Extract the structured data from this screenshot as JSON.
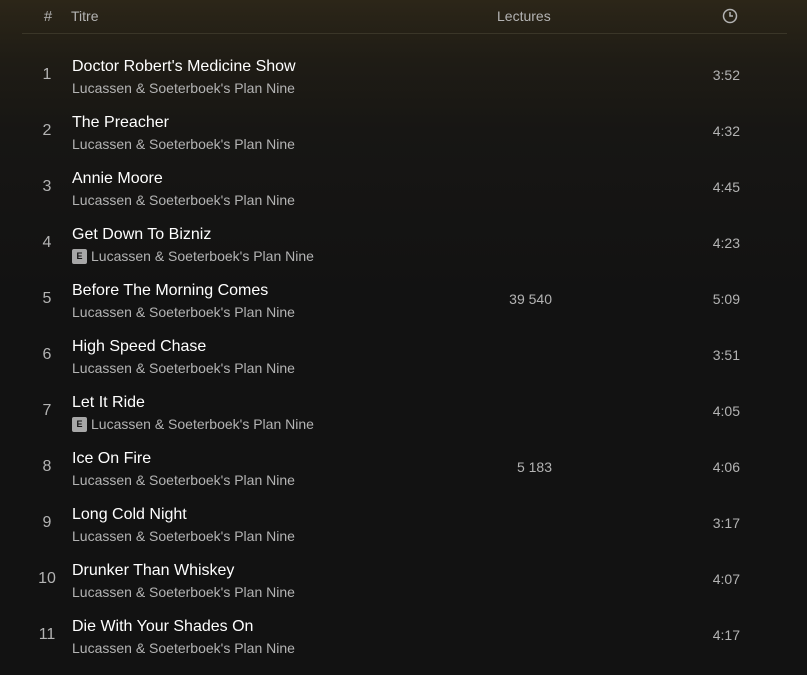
{
  "header": {
    "num_label": "#",
    "title_label": "Titre",
    "plays_label": "Lectures",
    "duration_icon": "clock-icon"
  },
  "tracks": [
    {
      "num": "1",
      "title": "Doctor Robert's Medicine Show",
      "artist": "Lucassen & Soeterboek's Plan Nine",
      "explicit": false,
      "explicit_label": "",
      "plays": "",
      "duration": "3:52"
    },
    {
      "num": "2",
      "title": "The Preacher",
      "artist": "Lucassen & Soeterboek's Plan Nine",
      "explicit": false,
      "explicit_label": "",
      "plays": "",
      "duration": "4:32"
    },
    {
      "num": "3",
      "title": "Annie Moore",
      "artist": "Lucassen & Soeterboek's Plan Nine",
      "explicit": false,
      "explicit_label": "",
      "plays": "",
      "duration": "4:45"
    },
    {
      "num": "4",
      "title": "Get Down To Bizniz",
      "artist": "Lucassen & Soeterboek's Plan Nine",
      "explicit": true,
      "explicit_label": "E",
      "plays": "",
      "duration": "4:23"
    },
    {
      "num": "5",
      "title": "Before The Morning Comes",
      "artist": "Lucassen & Soeterboek's Plan Nine",
      "explicit": false,
      "explicit_label": "",
      "plays": "39 540",
      "duration": "5:09"
    },
    {
      "num": "6",
      "title": "High Speed Chase",
      "artist": "Lucassen & Soeterboek's Plan Nine",
      "explicit": false,
      "explicit_label": "",
      "plays": "",
      "duration": "3:51"
    },
    {
      "num": "7",
      "title": "Let It Ride",
      "artist": "Lucassen & Soeterboek's Plan Nine",
      "explicit": true,
      "explicit_label": "E",
      "plays": "",
      "duration": "4:05"
    },
    {
      "num": "8",
      "title": "Ice On Fire",
      "artist": "Lucassen & Soeterboek's Plan Nine",
      "explicit": false,
      "explicit_label": "",
      "plays": "5 183",
      "duration": "4:06"
    },
    {
      "num": "9",
      "title": "Long Cold Night",
      "artist": "Lucassen & Soeterboek's Plan Nine",
      "explicit": false,
      "explicit_label": "",
      "plays": "",
      "duration": "3:17"
    },
    {
      "num": "10",
      "title": "Drunker Than Whiskey",
      "artist": "Lucassen & Soeterboek's Plan Nine",
      "explicit": false,
      "explicit_label": "",
      "plays": "",
      "duration": "4:07"
    },
    {
      "num": "11",
      "title": "Die With Your Shades On",
      "artist": "Lucassen & Soeterboek's Plan Nine",
      "explicit": false,
      "explicit_label": "",
      "plays": "",
      "duration": "4:17"
    }
  ]
}
